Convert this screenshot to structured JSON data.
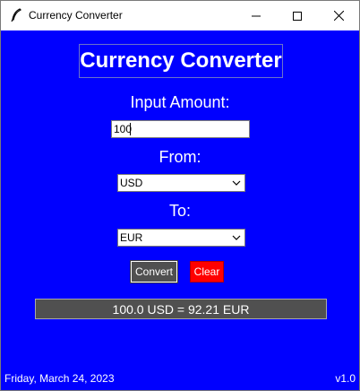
{
  "window": {
    "title": "Currency Converter"
  },
  "app": {
    "heading": "Currency Converter",
    "amount_label": "Input Amount:",
    "amount_value": "100",
    "from_label": "From:",
    "from_value": "USD",
    "to_label": "To:",
    "to_value": "EUR",
    "convert_label": "Convert",
    "clear_label": "Clear",
    "result": "100.0 USD = 92.21 EUR",
    "date": "Friday, March 24, 2023",
    "version": "v1.0"
  },
  "colors": {
    "background": "#0000ff",
    "convert_button": "#505050",
    "clear_button": "#ff0000",
    "result_bar": "#505050",
    "text": "#ffffff"
  },
  "icons": {
    "app": "feather-icon",
    "minimize": "minimize-icon",
    "maximize": "maximize-icon",
    "close": "close-icon",
    "dropdown": "chevron-down-icon"
  }
}
